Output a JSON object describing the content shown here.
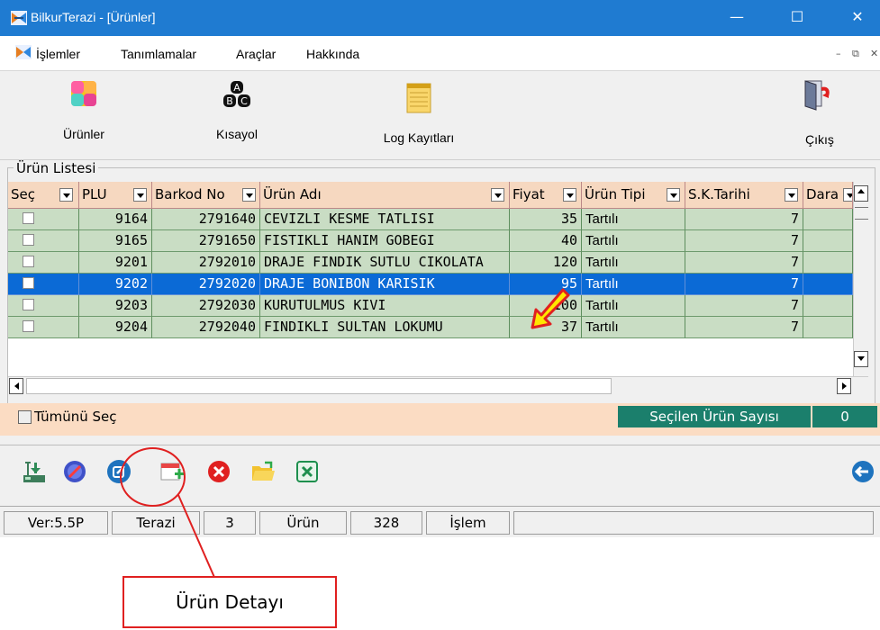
{
  "window": {
    "title": "BilkurTerazi  - [Ürünler]",
    "minimize": "—",
    "maximize": "☐",
    "close": "✕"
  },
  "menu": {
    "items": [
      "İşlemler",
      "Tanımlamalar",
      "Araçlar",
      "Hakkında"
    ],
    "mdi_min": "–",
    "mdi_restore": "⧉",
    "mdi_close": "✕"
  },
  "toolbar": {
    "urunler": "Ürünler",
    "kisayol": "Kısayol",
    "log": "Log Kayıtları",
    "cikis": "Çıkış"
  },
  "list": {
    "group_title": "Ürün Listesi",
    "columns": [
      "Seç",
      "PLU",
      "Barkod No",
      "Ürün Adı",
      "Fiyat",
      "Ürün Tipi",
      "S.K.Tarihi",
      "Dara"
    ],
    "rows": [
      {
        "plu": "9164",
        "barkod": "2791640",
        "ad": "CEVIZLI KESME TATLISI",
        "fiyat": "35",
        "tip": "Tartılı",
        "skt": "7",
        "selected": false
      },
      {
        "plu": "9165",
        "barkod": "2791650",
        "ad": "FISTIKLI HANIM GOBEGI",
        "fiyat": "40",
        "tip": "Tartılı",
        "skt": "7",
        "selected": false
      },
      {
        "plu": "9201",
        "barkod": "2792010",
        "ad": "DRAJE FINDIK SUTLU CIKOLATA",
        "fiyat": "120",
        "tip": "Tartılı",
        "skt": "7",
        "selected": false
      },
      {
        "plu": "9202",
        "barkod": "2792020",
        "ad": "DRAJE BONIBON KARISIK",
        "fiyat": "95",
        "tip": "Tartılı",
        "skt": "7",
        "selected": true
      },
      {
        "plu": "9203",
        "barkod": "2792030",
        "ad": "KURUTULMUS KIVI",
        "fiyat": "100",
        "tip": "Tartılı",
        "skt": "7",
        "selected": false
      },
      {
        "plu": "9204",
        "barkod": "2792040",
        "ad": "FINDIKLI SULTAN LOKUMU",
        "fiyat": "37",
        "tip": "Tartılı",
        "skt": "7",
        "selected": false
      }
    ],
    "select_all": "Tümünü Seç",
    "selected_count_label": "Seçilen Ürün Sayısı",
    "selected_count": "0"
  },
  "bottom_icons": [
    "scale-upload-icon",
    "brush-icon",
    "edit-icon",
    "calendar-add-icon",
    "delete-icon",
    "folder-open-icon",
    "excel-icon",
    "back-icon"
  ],
  "status": {
    "version": "Ver:5.5P",
    "terazi_label": "Terazi",
    "terazi_count": "3",
    "urun_label": "Ürün",
    "urun_count": "328",
    "islem_label": "İşlem"
  },
  "callout": {
    "label": "Ürün Detayı"
  },
  "colors": {
    "titlebar": "#1f7bd1",
    "header": "#f6d8c0",
    "row": "#c9ddc4",
    "selected_row": "#0b6ad6",
    "counter": "#1b7f6c",
    "callout": "#e02020"
  }
}
